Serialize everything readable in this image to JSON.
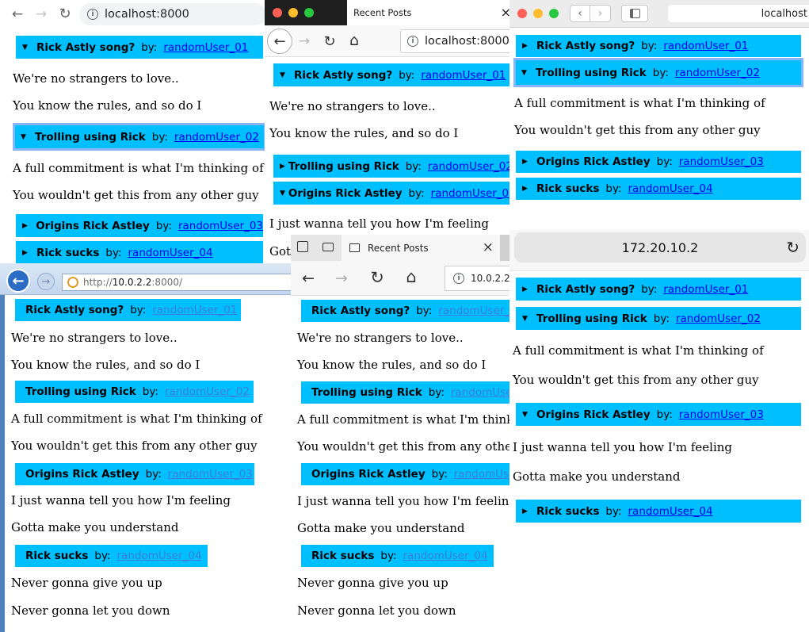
{
  "posts": [
    {
      "title": "Rick Astly song?",
      "by": "by:",
      "author": "randomUser_01",
      "lines": [
        "We're no strangers to love..",
        "You know the rules, and so do I"
      ]
    },
    {
      "title": "Trolling using Rick",
      "by": "by:",
      "author": "randomUser_02",
      "lines": [
        "A full commitment is what I'm thinking of",
        "You wouldn't get this from any other guy"
      ]
    },
    {
      "title": "Origins Rick Astley",
      "by": "by:",
      "author": "randomUser_03",
      "lines": [
        "I just wanna tell you how I'm feeling",
        "Gotta make you understand"
      ]
    },
    {
      "title": "Rick sucks",
      "by": "by:",
      "author": "randomUser_04",
      "lines": [
        "Never gonna give you up",
        "Never gonna let you down"
      ]
    }
  ],
  "chrome": {
    "url": "localhost:8000",
    "info": "i"
  },
  "firefox_mac": {
    "tab_title": "Recent Posts",
    "tab_close": "×",
    "url": "localhost:8000",
    "info": "i"
  },
  "safari_mac": {
    "url": "localhost"
  },
  "safari_ios": {
    "url": "172.20.10.2"
  },
  "ie": {
    "url_prefix": "http://",
    "url_host": "10.0.2.2",
    "url_suffix": ":8000/"
  },
  "edge": {
    "tab_title": "Recent Posts",
    "tab_close": "×",
    "url": "10.0.2.2",
    "info": "i"
  },
  "icons": {
    "back": "←",
    "forward": "→",
    "reload": "↻",
    "home": "⌂",
    "expanded": "▼",
    "collapsed": "▶",
    "ie_back": "←",
    "ie_forward": "→"
  },
  "colors": {
    "header_bg": "#00bfff",
    "link": "#0000ee",
    "focus": "#8ab4f8",
    "ie_frame": "#4f81bd"
  }
}
